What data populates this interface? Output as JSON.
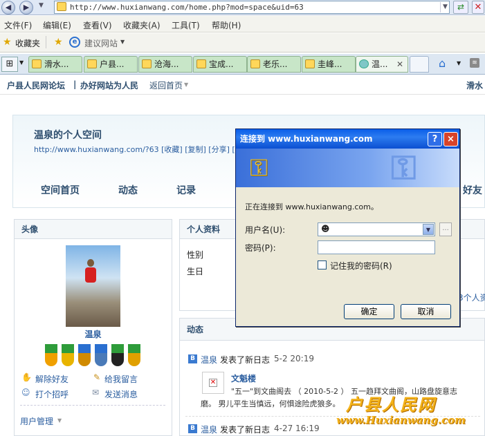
{
  "browser": {
    "url": "http://www.huxianwang.com/home.php?mod=space&uid=63",
    "menu": [
      "文件(F)",
      "编辑(E)",
      "查看(V)",
      "收藏夹(A)",
      "工具(T)",
      "帮助(H)"
    ],
    "favorites_label": "收藏夹",
    "suggested_sites_label": "建议网站",
    "tabs": [
      "滑水...",
      "户县...",
      "沧海...",
      "宝成...",
      "老乐...",
      "圭峰...",
      "温..."
    ]
  },
  "site": {
    "nav_title": "户县人民网论坛",
    "slogan": "办好网站为人民",
    "back_home": "返回首页",
    "user_right": "滑水",
    "space_title": "温泉的个人空间",
    "space_url": "http://www.huxianwang.com/?63",
    "space_url_actions": "[收藏] [复制] [分享] [R",
    "nav_tabs": [
      "空间首页",
      "动态",
      "记录"
    ],
    "nav_right": "好友"
  },
  "avatar_panel": {
    "header": "头像",
    "username": "温泉",
    "actions": [
      "解除好友",
      "给我留言",
      "打个招呼",
      "发送消息"
    ],
    "user_manage": "用户管理"
  },
  "profile_panel": {
    "header": "个人资料",
    "fields": [
      "性别",
      "生日"
    ],
    "right_partial": "3个人资"
  },
  "feed": {
    "header": "动态",
    "items": [
      {
        "user": "温泉",
        "action": "发表了新日志",
        "time": "5-2 20:19",
        "title": "文魁楼",
        "excerpt_line1": "\"五一\"到文曲阁去 （ 2010-5-2 ） 五一趋拜文曲阁，山路盘旋意志",
        "excerpt_line2": "磨。 男儿平生当慎远，何惧途险虎狼多。"
      },
      {
        "user": "温泉",
        "action": "发表了新日志",
        "time": "4-27 16:19"
      }
    ]
  },
  "watermark": {
    "line1": "户县人民网",
    "line2": "www.Huxianwang.com"
  },
  "dialog": {
    "title": "连接到 www.huxianwang.com",
    "help": "?",
    "close": "×",
    "connecting_text": "正在连接到 www.huxianwang.com。",
    "username_label": "用户名(U):",
    "password_label": "密码(P):",
    "remember_label": "记住我的密码(R)",
    "remember_checked": false,
    "ok_label": "确定",
    "cancel_label": "取消",
    "browse_label": "..."
  },
  "colors": {
    "accent": "#2a5d9f",
    "dialog_title": "#0a5ee8",
    "tab_bg": "#c8e6c8"
  }
}
